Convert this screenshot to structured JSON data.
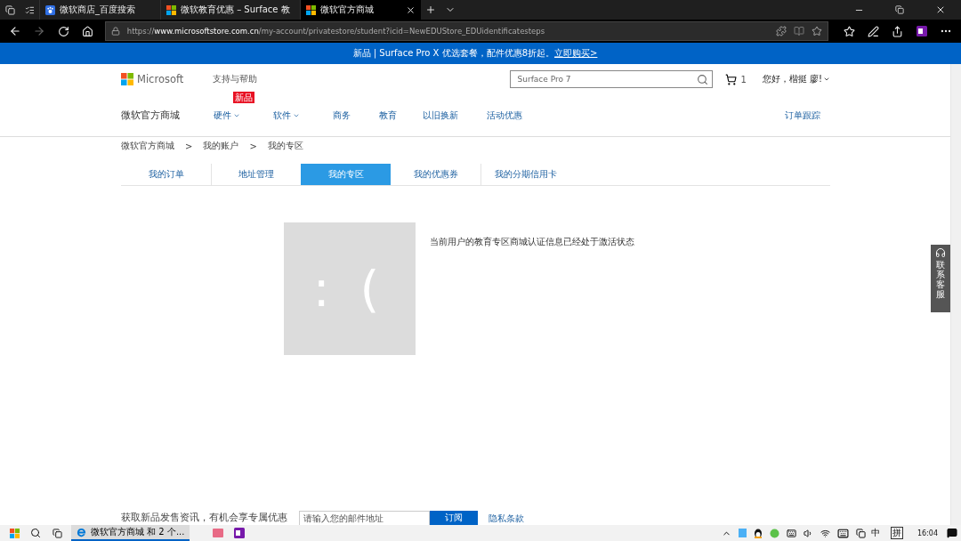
{
  "browser_tabs": [
    {
      "title": "微软商店_百度搜索",
      "kind": "paw",
      "selected": false
    },
    {
      "title": "微软教育优惠 – Surface 教",
      "kind": "windows",
      "selected": false
    },
    {
      "title": "微软官方商城",
      "kind": "windows",
      "selected": true
    }
  ],
  "address_bar": {
    "url_prefix": "https://",
    "url_domain": "www.microsoftstore.com.cn",
    "url_path": "/my-account/privatestore/student?icid=NewEDUStore_EDUidentificatesteps"
  },
  "banner": {
    "text": "新品 | Surface Pro X 优选套餐，配件优惠8折起。",
    "link": "立即购买>"
  },
  "header": {
    "logo": "Microsoft",
    "support": "支持与帮助",
    "search": {
      "value": "Surface Pro 7"
    },
    "cart_count": "1",
    "greeting": "您好，楷挺 廖!"
  },
  "nav": {
    "store_name": "微软官方商城",
    "items": [
      {
        "label": "硬件",
        "dropdown": true,
        "badge": "新品"
      },
      {
        "label": "软件",
        "dropdown": true
      },
      {
        "label": "商务",
        "dropdown": false
      },
      {
        "label": "教育",
        "dropdown": false
      },
      {
        "label": "以旧换新",
        "dropdown": false
      },
      {
        "label": "活动优惠",
        "dropdown": false
      }
    ],
    "order_tracking": "订单跟踪"
  },
  "breadcrumb": {
    "items": [
      "微软官方商城",
      "我的账户",
      "我的专区"
    ],
    "separator": ">"
  },
  "account_tabs": [
    {
      "label": "我的订单",
      "selected": false
    },
    {
      "label": "地址管理",
      "selected": false
    },
    {
      "label": "我的专区",
      "selected": true
    },
    {
      "label": "我的优惠券",
      "selected": false
    },
    {
      "label": "我的分期信用卡",
      "selected": false
    }
  ],
  "status": {
    "face": ": (",
    "message": "当前用户的教育专区商城认证信息已经处于激活状态"
  },
  "support_widget": {
    "label": "联系客服"
  },
  "footer": {
    "subscribe_text": "获取新品发售资讯，有机会享专属优惠",
    "email": {
      "placeholder": "请输入您的邮件地址"
    },
    "subscribe_button": "订阅",
    "privacy": "隐私条款"
  },
  "taskbar": {
    "active_app": "微软官方商城 和 2 个...",
    "ime_mode": "中",
    "ime_name": "拼",
    "time": "16:04"
  }
}
